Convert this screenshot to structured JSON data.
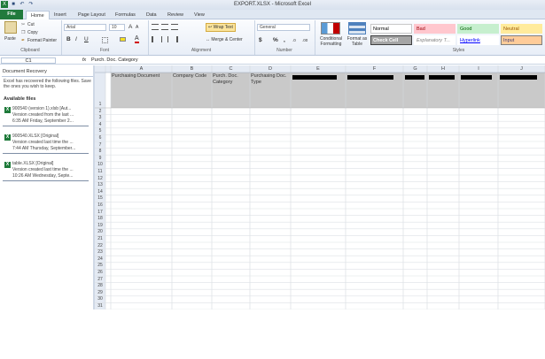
{
  "window": {
    "title": "EXPORT.XLSX - Microsoft Excel"
  },
  "icons": [
    "excel-icon",
    "save-icon",
    "undo-icon",
    "redo-icon",
    "paste-icon",
    "cut-icon",
    "copy-icon",
    "format-painter-icon",
    "bold-icon",
    "italic-icon",
    "underline-icon",
    "border-icon",
    "fill-color-icon",
    "font-color-icon",
    "align-left-icon",
    "align-center-icon",
    "align-right-icon",
    "wrap-text-icon",
    "merge-icon",
    "currency-icon",
    "percent-icon",
    "comma-icon",
    "conditional-formatting-icon",
    "format-as-table-icon"
  ],
  "tabs": {
    "file": "File",
    "home": "Home",
    "insert": "Insert",
    "page_layout": "Page Layout",
    "formulas": "Formulas",
    "data": "Data",
    "review": "Review",
    "view": "View"
  },
  "ribbon": {
    "clipboard": {
      "label": "Clipboard",
      "paste": "Paste",
      "cut": "Cut",
      "copy": "Copy",
      "format_painter": "Format Painter"
    },
    "font": {
      "label": "Font",
      "font_name": "Arial",
      "font_size": "10",
      "bold": "B",
      "italic": "I",
      "underline": "U",
      "grow": "A",
      "shrink": "A",
      "font_color": "A"
    },
    "alignment": {
      "label": "Alignment",
      "wrap": "Wrap Text",
      "merge": "Merge & Center"
    },
    "number": {
      "label": "Number",
      "format": "General",
      "currency": "$",
      "percent": "%",
      "comma": ",",
      "inc_decimal": ".0",
      "dec_decimal": ".00"
    },
    "styles": {
      "label": "Styles",
      "cond_format": "Conditional Formatting",
      "format_table": "Format as Table",
      "items": [
        {
          "label": "Normal",
          "bg": "#ffffff",
          "fg": "#000000",
          "border": "#c8c8c8"
        },
        {
          "label": "Bad",
          "bg": "#ffc7ce",
          "fg": "#9c0006",
          "border": "#ffc7ce"
        },
        {
          "label": "Good",
          "bg": "#c6efce",
          "fg": "#006100",
          "border": "#c6efce"
        },
        {
          "label": "Neutral",
          "bg": "#ffeb9c",
          "fg": "#9c5700",
          "border": "#ffeb9c"
        },
        {
          "label": "Check Cell",
          "bg": "#a5a5a5",
          "fg": "#ffffff",
          "border": "#3f3f3f"
        },
        {
          "label": "Explanatory T...",
          "bg": "#ffffff",
          "fg": "#7f7f7f",
          "border": "#ffffff"
        },
        {
          "label": "Hyperlink",
          "bg": "#ffffff",
          "fg": "#0000ff",
          "border": "#ffffff"
        },
        {
          "label": "Input",
          "bg": "#ffcc99",
          "fg": "#3f3f76",
          "border": "#7f7f7f"
        }
      ]
    }
  },
  "formula_bar": {
    "name_box": "C1",
    "fx": "fx",
    "content": "Purch. Doc. Category"
  },
  "recovery": {
    "title": "Document Recovery",
    "message": "Excel has recovered the following files. Save the ones you wish to keep.",
    "available": "Available files",
    "files": [
      {
        "name": "900540 (version 1).xlsb  [Aut...",
        "line2": "Version created from the last ...",
        "line3": "6:35 AM Friday, September 2..."
      },
      {
        "name": "900540.XLSX  [Original]",
        "line2": "Version created last time the ...",
        "line3": "7:44 AM Thursday, September..."
      },
      {
        "name": "table.XLSX  [Original]",
        "line2": "Version created last time the ...",
        "line3": "10:26 AM Wednesday, Septe..."
      }
    ]
  },
  "sheet": {
    "columns": [
      "A",
      "B",
      "C",
      "D",
      "E",
      "F",
      "G",
      "H",
      "I",
      "J"
    ],
    "headers": [
      "Purchasing Document",
      "Company Code",
      "Purch. Doc. Category",
      "Purchasing Doc. Type",
      "",
      "",
      "",
      "",
      "",
      ""
    ],
    "redacted_columns": [
      4,
      5,
      6,
      7,
      8,
      9
    ],
    "rows": [
      "1",
      "2",
      "3",
      "4",
      "5",
      "6",
      "7",
      "8",
      "9",
      "10",
      "11",
      "12",
      "13",
      "14",
      "15",
      "16",
      "17",
      "18",
      "19",
      "20",
      "21",
      "22",
      "23",
      "24",
      "25",
      "26",
      "27",
      "28",
      "29",
      "30",
      "31"
    ]
  }
}
